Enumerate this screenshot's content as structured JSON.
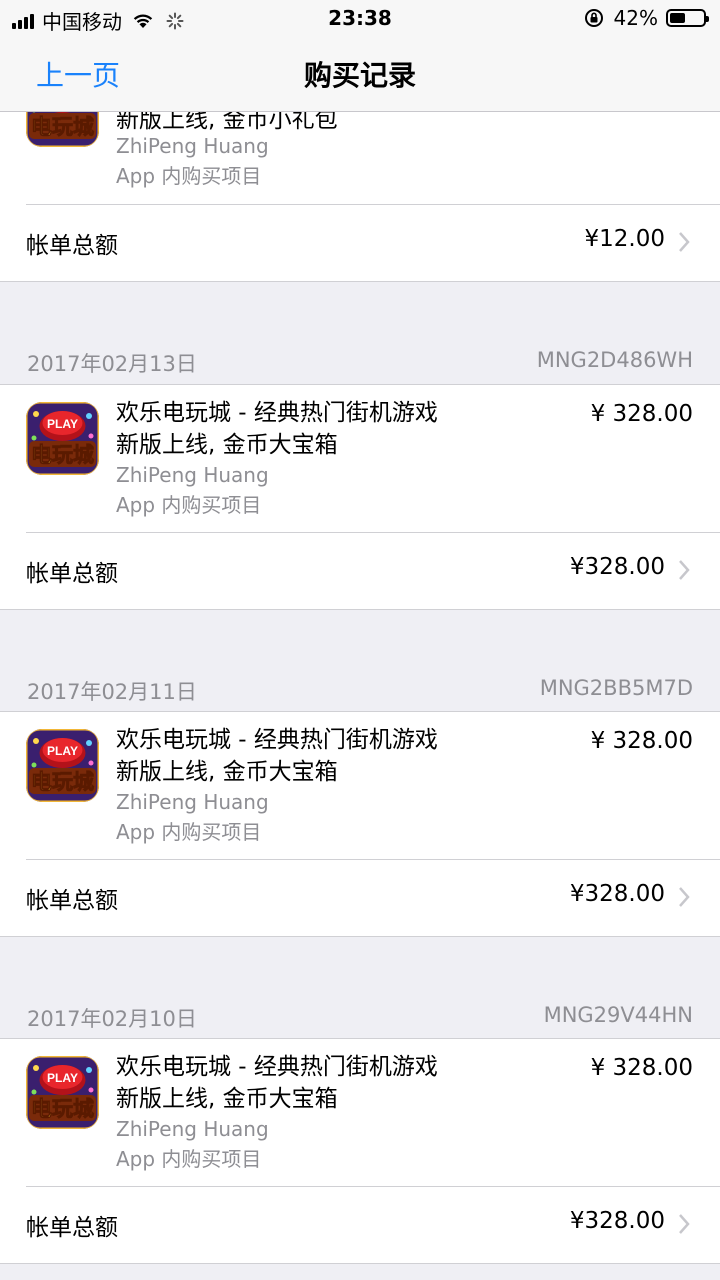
{
  "status_bar": {
    "carrier": "中国移动",
    "time": "23:38",
    "battery": "42%",
    "battery_level": 0.42
  },
  "nav": {
    "back_label": "上一页",
    "title": "购买记录"
  },
  "top_partial": {
    "line2": "新版上线, 金币小礼包",
    "developer": "ZhiPeng Huang",
    "kind": "App 内购买项目",
    "total_label": "帐单总额",
    "total": "¥12.00"
  },
  "purchases": [
    {
      "date": "2017年02月13日",
      "order_id": "MNG2D486WH",
      "title_line1": "欢乐电玩城 - 经典热门街机游戏",
      "title_line2": "新版上线, 金币大宝箱",
      "developer": "ZhiPeng Huang",
      "kind": "App 内购买项目",
      "price": "¥ 328.00",
      "total_label": "帐单总额",
      "total": "¥328.00"
    },
    {
      "date": "2017年02月11日",
      "order_id": "MNG2BB5M7D",
      "title_line1": "欢乐电玩城 - 经典热门街机游戏",
      "title_line2": "新版上线, 金币大宝箱",
      "developer": "ZhiPeng Huang",
      "kind": "App 内购买项目",
      "price": "¥ 328.00",
      "total_label": "帐单总额",
      "total": "¥328.00"
    },
    {
      "date": "2017年02月10日",
      "order_id": "MNG29V44HN",
      "title_line1": "欢乐电玩城 - 经典热门街机游戏",
      "title_line2": "新版上线, 金币大宝箱",
      "developer": "ZhiPeng Huang",
      "kind": "App 内购买项目",
      "price": "¥ 328.00",
      "total_label": "帐单总额",
      "total": "¥328.00"
    }
  ],
  "app_icon": {
    "name": "play-game-icon",
    "text_top": "PLAY",
    "text_bottom": "电玩城"
  },
  "colors": {
    "accent": "#1a82fb",
    "secondary_text": "#8e8e93",
    "background": "#efeff4"
  }
}
